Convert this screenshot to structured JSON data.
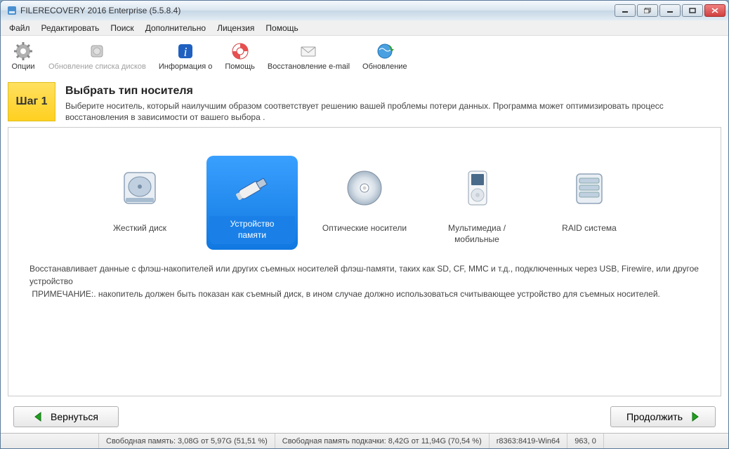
{
  "window": {
    "title": "FILERECOVERY 2016 Enterprise (5.5.8.4)"
  },
  "menu": {
    "file": "Файл",
    "edit": "Редактировать",
    "search": "Поиск",
    "extra": "Дополнительно",
    "license": "Лицензия",
    "help": "Помощь"
  },
  "toolbar": {
    "options": "Опции",
    "refresh": "Обновление списка дисков",
    "about": "Информация о",
    "help": "Помощь",
    "email": "Восстановление e-mail",
    "update": "Обновление"
  },
  "step": {
    "badge": "Шаг 1",
    "title": "Выбрать тип носителя",
    "desc": "Выберите носитель, который наилучшим образом соответствует решению вашей проблемы потери данных. Программа может оптимизировать процесс восстановления в зависимости от вашего выбора ."
  },
  "media": {
    "hdd": "Жесткий диск",
    "flash": "Устройство памяти",
    "optical": "Оптические носители",
    "multimedia": "Мультимедиа / мобильные",
    "raid": "RAID система"
  },
  "description": {
    "line1": "Восстанавливает данные с флэш-накопителей или других съемных носителей флэш-памяти, таких как SD, CF, MMC и т.д., подключенных через USB, Firewire, или другое устройство",
    "line2": " ПРИМЕЧАНИЕ:. накопитель должен быть показан как съемный диск, в ином случае должно использоваться считывающее устройство для съемных носителей."
  },
  "nav": {
    "back": "Вернуться",
    "next": "Продолжить"
  },
  "status": {
    "mem": "Свободная память: 3,08G от 5,97G (51,51 %)",
    "swap": "Свободная память подкачки: 8,42G от 11,94G (70,54 %)",
    "build": "r8363:8419-Win64",
    "extra": "963, 0"
  }
}
